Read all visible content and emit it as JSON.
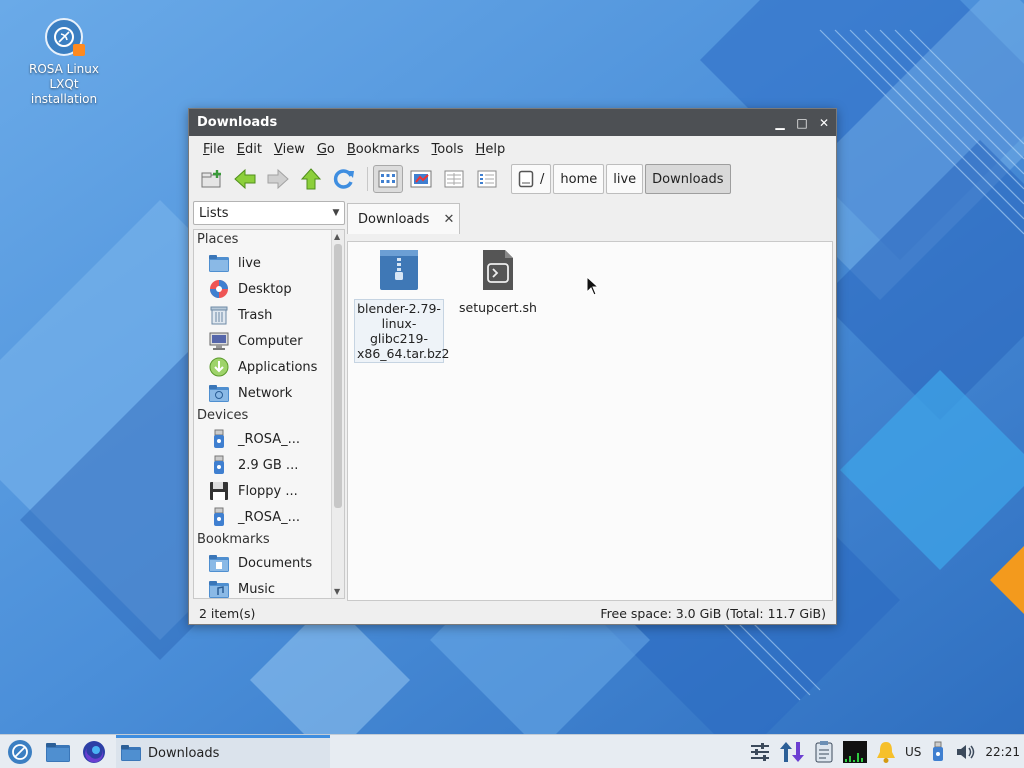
{
  "desktop": {
    "icon_label_line1": "ROSA Linux",
    "icon_label_line2": "LXQt",
    "icon_label_line3": "installation"
  },
  "window": {
    "title": "Downloads",
    "controls": {
      "minimize": "▁",
      "maximize": "□",
      "close": "✕"
    }
  },
  "menu": [
    {
      "key": "F",
      "rest": "ile"
    },
    {
      "key": "E",
      "rest": "dit"
    },
    {
      "key": "V",
      "rest": "iew"
    },
    {
      "key": "G",
      "rest": "o"
    },
    {
      "key": "B",
      "rest": "ookmarks"
    },
    {
      "key": "T",
      "rest": "ools"
    },
    {
      "key": "H",
      "rest": "elp"
    }
  ],
  "breadcrumb": {
    "root": "/",
    "items": [
      "home",
      "live",
      "Downloads"
    ]
  },
  "sidepane": {
    "mode": "Lists",
    "sections": {
      "places": "Places",
      "devices": "Devices",
      "bookmarks": "Bookmarks"
    },
    "places": [
      "live",
      "Desktop",
      "Trash",
      "Computer",
      "Applications",
      "Network"
    ],
    "devices": [
      "_ROSA_...",
      "2.9 GB ...",
      "Floppy ...",
      "_ROSA_..."
    ],
    "bookmarks": [
      "Documents",
      "Music"
    ]
  },
  "tabs": [
    {
      "label": "Downloads",
      "close": "✕"
    }
  ],
  "files": [
    {
      "name_l1": "blender-2.79-",
      "name_l2": "linux-glibc219-",
      "name_l3": "x86_64.tar.bz2"
    },
    {
      "name_l1": "setupcert.sh"
    }
  ],
  "status": {
    "items": "2 item(s)",
    "free_space": "Free space: 3.0 GiB (Total: 11.7 GiB)"
  },
  "taskbar": {
    "task_label": "Downloads",
    "keyboard_layout": "US",
    "clock": "22:21"
  },
  "colors": {
    "accent": "#3f8ee0",
    "titlebar": "#4d5054",
    "folder": "#4f8fd0",
    "wallpaper_base": "#4a8fd8"
  }
}
